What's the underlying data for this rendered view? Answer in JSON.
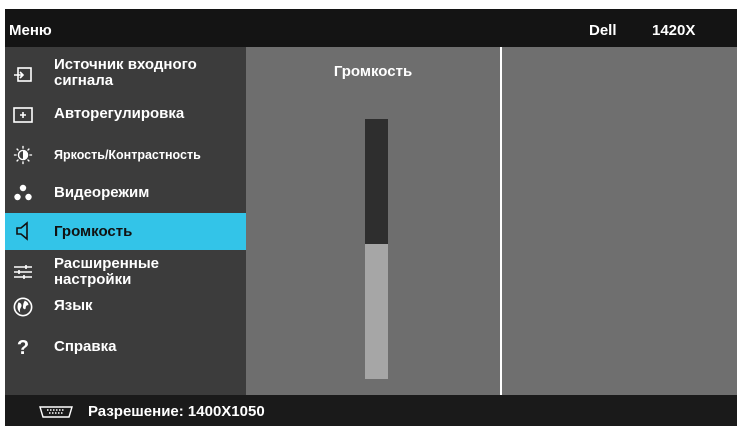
{
  "header": {
    "menu_title": "Меню",
    "brand": "Dell",
    "model": "1420X"
  },
  "sidebar": {
    "items": [
      {
        "label": "Источник входного\nсигнала",
        "icon": "input-source-icon"
      },
      {
        "label": "Авторегулировка",
        "icon": "auto-adjust-icon"
      },
      {
        "label": "Яркость/Контрастность",
        "icon": "brightness-icon"
      },
      {
        "label": "Видеорежим",
        "icon": "video-mode-icon"
      },
      {
        "label": "Громкость",
        "icon": "volume-icon",
        "active": true
      },
      {
        "label": "Расширенные\nнастройки",
        "icon": "advanced-settings-icon"
      },
      {
        "label": "Язык",
        "icon": "globe-icon"
      },
      {
        "label": "Справка",
        "icon": "help-icon"
      }
    ]
  },
  "panel": {
    "title": "Громкость",
    "volume_level": 0.52
  },
  "footer": {
    "resolution": "Разрешение: 1400X1050",
    "icon": "vga-connector-icon"
  },
  "colors": {
    "accent": "#33c4e8",
    "header": "#141414",
    "sidebar": "#3c3c3c",
    "panel": "#6f6f6f"
  }
}
